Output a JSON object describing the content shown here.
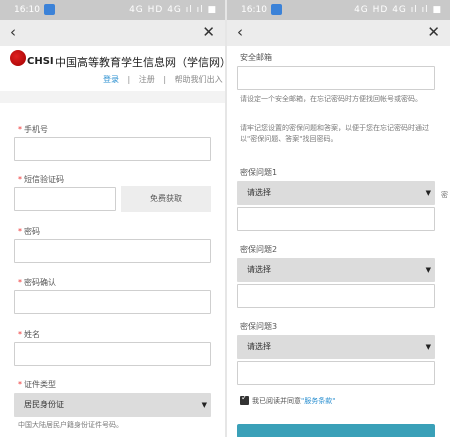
{
  "left": {
    "status": {
      "time": "16:10",
      "network": "4G HD 4G ıl ıl ■"
    },
    "nav": {
      "back": "‹",
      "close": "✕"
    },
    "header": {
      "logo_text": "CHSI",
      "site_name": "中国高等教育学生信息网（学信网）"
    },
    "topnav": {
      "login": "登录",
      "sep1": "|",
      "register": "注册",
      "sep2": "|",
      "help": "帮助我们出入"
    },
    "fields": {
      "phone": "手机号",
      "code": "短信验证码",
      "get_code": "免费获取",
      "password": "密码",
      "confirm": "密码确认",
      "name": "姓名",
      "id_type": "证件类型",
      "id_type_value": "居民身份证",
      "note": "中国大陆居民户籍身份证件号码。"
    }
  },
  "right": {
    "status": {
      "time": "16:10",
      "network": "4G HD 4G ıl ıl ■"
    },
    "nav": {
      "back": "‹",
      "close": "✕"
    },
    "email_label": "安全邮箱",
    "hint1": "请设定一个安全邮箱，在忘记密码时方便找回帐号或密码。",
    "hint2": "请牢记您设置的密保问题和答案，以便于您在忘记密码时通过以\"密保问题、答案\"找回密码。",
    "q1_label": "密保问题1",
    "q1_value": "请选择",
    "q2_label": "密保问题2",
    "q2_value": "请选择",
    "q3_label": "密保问题3",
    "q3_value": "请选择",
    "agree_text": "我已阅读并同意",
    "agree_link": "\"服务条款\"",
    "side_mark": "密"
  }
}
